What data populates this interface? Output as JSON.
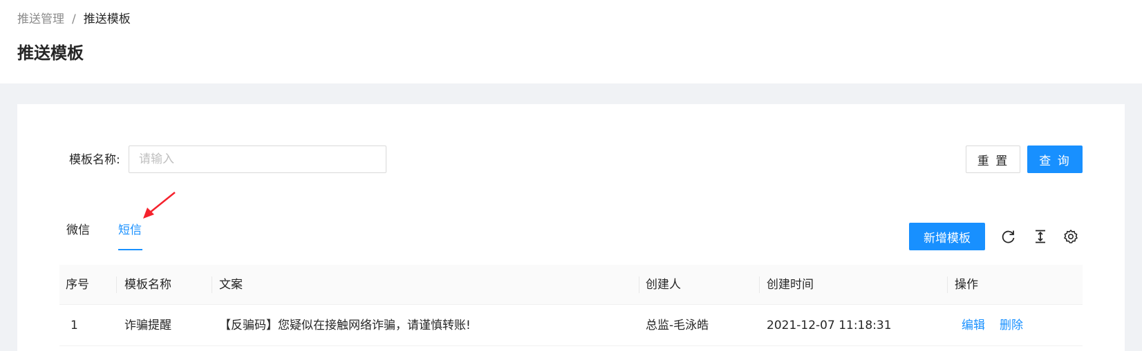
{
  "breadcrumb": {
    "parent": "推送管理",
    "separator": "/",
    "current": "推送模板"
  },
  "page_title": "推送模板",
  "search": {
    "label": "模板名称:",
    "placeholder": "请输入",
    "value": ""
  },
  "buttons": {
    "reset": "重 置",
    "query": "查 询",
    "add": "新增模板"
  },
  "tabs": [
    {
      "label": "微信",
      "active": false
    },
    {
      "label": "短信",
      "active": true
    }
  ],
  "toolbar_icons": [
    "reload-icon",
    "column-height-icon",
    "setting-icon"
  ],
  "table": {
    "columns": [
      "序号",
      "模板名称",
      "文案",
      "创建人",
      "创建时间",
      "操作"
    ],
    "rows": [
      {
        "index": "1",
        "name": "诈骗提醒",
        "content": "【反骗码】您疑似在接触网络诈骗，请谨慎转账!",
        "creator": "总监-毛泳皓",
        "created_at": "2021-12-07 11:18:31",
        "actions": {
          "edit": "编辑",
          "delete": "删除"
        }
      }
    ]
  },
  "colors": {
    "primary": "#1890ff",
    "annotation_arrow": "#f5222d"
  }
}
